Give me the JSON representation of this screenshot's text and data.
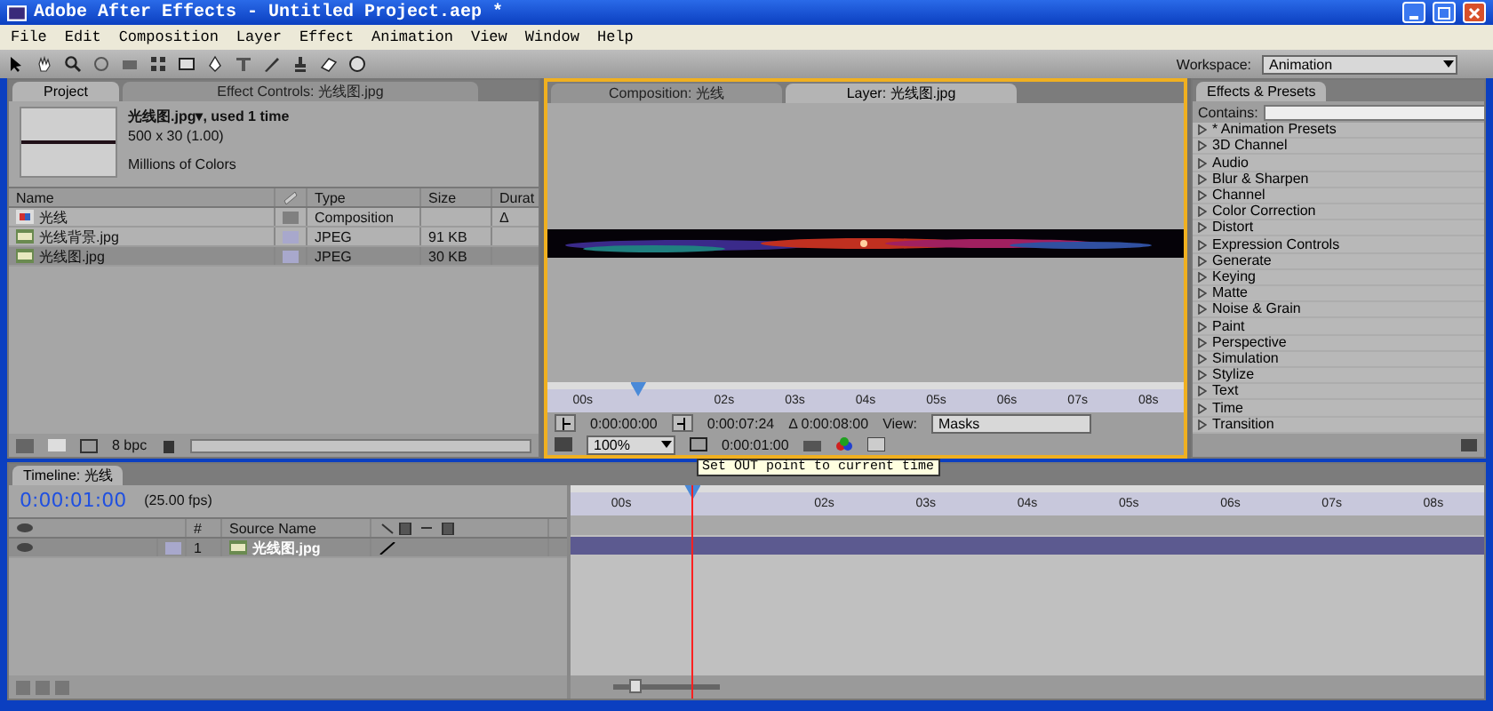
{
  "window": {
    "title": "Adobe After Effects - Untitled Project.aep *"
  },
  "menu": [
    "File",
    "Edit",
    "Composition",
    "Layer",
    "Effect",
    "Animation",
    "View",
    "Window",
    "Help"
  ],
  "workspace": {
    "label": "Workspace:",
    "value": "Animation"
  },
  "project": {
    "tabs": [
      {
        "label": "Project",
        "selected": true
      },
      {
        "label": "Effect Controls: 光线图.jpg",
        "selected": false
      }
    ],
    "info": {
      "name": "光线图.jpg▾, used 1 time",
      "dimensions": "500 x 30 (1.00)",
      "colors": "Millions of Colors"
    },
    "columns": [
      "Name",
      "Type",
      "Size",
      "Durat"
    ],
    "rows": [
      {
        "kind": "composition",
        "name": "光线",
        "type": "Composition",
        "size": "",
        "color": "#808080",
        "selected": false,
        "marker": "Δ"
      },
      {
        "kind": "footage",
        "name": "光线背景.jpg",
        "type": "JPEG",
        "size": "91 KB",
        "color": "#a8a8cc",
        "selected": false,
        "marker": ""
      },
      {
        "kind": "footage",
        "name": "光线图.jpg",
        "type": "JPEG",
        "size": "30 KB",
        "color": "#a8a8cc",
        "selected": true,
        "marker": ""
      }
    ],
    "depth": "8 bpc"
  },
  "viewer": {
    "tabs": [
      {
        "label": "Composition: 光线",
        "selected": false
      },
      {
        "label": "Layer: 光线图.jpg",
        "selected": true
      }
    ],
    "ruler": [
      "00s",
      "02s",
      "03s",
      "04s",
      "05s",
      "06s",
      "07s",
      "08s"
    ],
    "in_time": "0:00:00:00",
    "out_time": "0:00:07:24",
    "duration": "Δ 0:00:08:00",
    "view_label": "View:",
    "view_value": "Masks",
    "zoom": "100%",
    "current_time": "0:00:01:00",
    "tooltip": "Set OUT point to current time"
  },
  "effects": {
    "tab": "Effects & Presets",
    "contains_label": "Contains:",
    "items": [
      "* Animation Presets",
      "3D Channel",
      "Audio",
      "Blur & Sharpen",
      "Channel",
      "Color Correction",
      "Distort",
      "Expression Controls",
      "Generate",
      "Keying",
      "Matte",
      "Noise & Grain",
      "Paint",
      "Perspective",
      "Simulation",
      "Stylize",
      "Text",
      "Time",
      "Transition"
    ]
  },
  "timeline": {
    "tab": "Timeline: 光线",
    "time": "0:00:01:00",
    "fps": "(25.00 fps)",
    "columns": [
      "#",
      "Source Name"
    ],
    "zoom": {
      "level": 0.2
    },
    "layers": [
      {
        "number": "1",
        "name": "光线图.jpg",
        "color": "#a8a8cc",
        "selected": true
      }
    ],
    "ruler": [
      "00s",
      "02s",
      "03s",
      "04s",
      "05s",
      "06s",
      "07s",
      "08s"
    ]
  }
}
